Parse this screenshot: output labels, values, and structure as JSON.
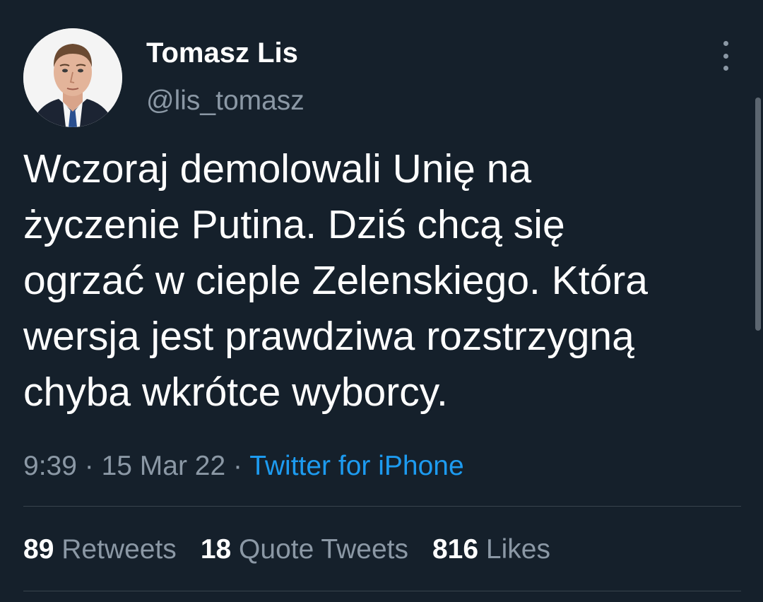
{
  "author": {
    "display_name": "Tomasz Lis",
    "handle": "@lis_tomasz",
    "avatar_icon": "profile-photo-man-in-suit"
  },
  "menu": {
    "more_icon": "more-vertical-icon"
  },
  "tweet": {
    "text": "Wczoraj demolowali  Unię   na\nżyczenie Putina. Dziś chcą się\nogrzać w cieple Zelenskiego. Która\nwersja jest prawdziwa rozstrzygną\nchyba wkrótce wyborcy.",
    "time": "9:39",
    "date": "15 Mar 22",
    "separator": "·",
    "source": "Twitter for iPhone"
  },
  "stats": {
    "retweets": {
      "count": "89",
      "label": "Retweets"
    },
    "quote_tweets": {
      "count": "18",
      "label": "Quote Tweets"
    },
    "likes": {
      "count": "816",
      "label": "Likes"
    }
  },
  "colors": {
    "background": "#15202b",
    "text_primary": "#ffffff",
    "text_secondary": "#8b98a5",
    "accent": "#1d9bf0",
    "divider": "#38444d"
  }
}
